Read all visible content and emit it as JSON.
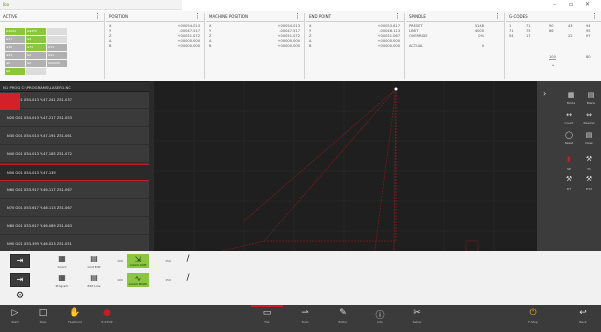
{
  "titlebar": {
    "app_label": "Ibo",
    "window_controls": [
      "–",
      "▫",
      "✕"
    ]
  },
  "infopanel": {
    "active": {
      "header": "ACTIVE",
      "cells": [
        [
          "G40X0",
          "G94T0",
          ""
        ],
        [
          "G17",
          "G4",
          "",
          ""
        ],
        [
          "G40",
          "G72",
          "G71",
          "G72"
        ],
        [
          "G21",
          "G0",
          "G91",
          "G90"
        ],
        [
          "G0",
          "G0",
          "",
          "G00000"
        ],
        [
          "G0",
          "G0.24L",
          "",
          ""
        ]
      ]
    },
    "position": {
      "header": "POSITION",
      "rows": [
        [
          "X",
          "+00054.013"
        ],
        [
          "Y",
          "-00047.517"
        ],
        [
          "Z",
          "+00051.072"
        ],
        [
          "A",
          "+00000.000"
        ],
        [
          "B",
          "+00000.000"
        ]
      ]
    },
    "machine_position": {
      "header": "MACHINE POSITION",
      "rows": [
        [
          "X",
          "+00054.013"
        ],
        [
          "Y",
          "-00047.517"
        ],
        [
          "Z",
          "+00051.072"
        ],
        [
          "A",
          "+00000.000"
        ],
        [
          "B",
          "+00000.000"
        ]
      ]
    },
    "end_point": {
      "header": "END POINT",
      "rows": [
        [
          "X",
          "+00053.617"
        ],
        [
          "Y",
          "-00046.113"
        ],
        [
          "Z",
          "+00051.067"
        ],
        [
          "A",
          "+00000.000"
        ],
        [
          "B",
          "+00000.000"
        ]
      ]
    },
    "spindle": {
      "header": "SPINDLE",
      "rows": [
        [
          "PRESET",
          "5148"
        ],
        [
          "LIMIT",
          "4000"
        ],
        [
          "OVERRIDE",
          "0%"
        ],
        [
          "",
          ""
        ],
        [
          "ACTUAL",
          "0"
        ]
      ]
    },
    "gcodes": {
      "header": "G-CODES",
      "grid": [
        [
          "1",
          "71",
          "90",
          "43",
          "94"
        ],
        [
          "71",
          "75",
          "66",
          "",
          "95"
        ],
        [
          "54",
          "17",
          "",
          "22",
          "97"
        ]
      ],
      "footer": [
        "100",
        "80"
      ]
    }
  },
  "program": {
    "header": "N1 PROG C:\\PROGRAMS\\LASER1.NC",
    "lines": [
      "N10 G01 X54.013 Y-47.241 Z51.037",
      "N20 G01 X54.013 Y-47.217 Z51.053",
      "N30 G01 X54.013 Y-47.191 Z51.061",
      "N40 G01 X54.013 Y-47.165 Z51.072",
      "N50 G01 X54.013 Y-47.139",
      "N60 G01 X53.917 Y-46.117 Z51.067",
      "N70 G01 X53.617 Y-46.113 Z51.067",
      "N80 G01 X53.617 Y-46.089 Z51.063",
      "N90 G01 X53.395 Y-46.023 Z51.051"
    ],
    "selected_index": 4
  },
  "graph": {
    "accent": "#c41e25",
    "trace_color": "#7d1d22",
    "grid_color": "#333333"
  },
  "sidepanel": {
    "items": [
      {
        "icon": "▦",
        "label": "Mode"
      },
      {
        "icon": "▤",
        "label": "Blank"
      },
      {
        "icon": "↔",
        "label": "Count"
      },
      {
        "icon": "⇔",
        "label": "Rewind"
      },
      {
        "icon": "◯",
        "label": "Reset"
      },
      {
        "icon": "▤",
        "label": "Clear"
      },
      {
        "icon": "▮",
        "label": "SP"
      },
      {
        "icon": "⚒",
        "label": "T1"
      },
      {
        "icon": "⚒",
        "label": "DT"
      },
      {
        "icon": "⚒",
        "label": "DT2"
      }
    ]
  },
  "softkeys": {
    "row1": [
      {
        "icon": "⇥",
        "label": "Feed"
      },
      {
        "icon": "▦",
        "label": "Coord"
      },
      {
        "icon": "▤",
        "label": "Grid Edit"
      },
      {
        "icon": "100",
        "label": ""
      },
      {
        "icon": "⇲",
        "label": "ALIGN LINE"
      },
      {
        "icon": "150",
        "label": ""
      },
      {
        "icon": "/",
        "label": ""
      }
    ],
    "row2": [
      {
        "icon": "⇥",
        "label": "Setup"
      },
      {
        "icon": "▦",
        "label": "Program"
      },
      {
        "icon": "▤",
        "label": "Edit Line"
      },
      {
        "icon": "100",
        "label": ""
      },
      {
        "icon": "∿",
        "label": "ALIGN MARK"
      },
      {
        "icon": "150",
        "label": ""
      },
      {
        "icon": "/",
        "label": ""
      }
    ],
    "row3": [
      {
        "icon": "⚙",
        "label": ""
      }
    ]
  },
  "bottombar": {
    "items": [
      {
        "icon": "▷",
        "label": "Start"
      },
      {
        "icon": "□",
        "label": "Stop"
      },
      {
        "icon": "✋",
        "label": "Feedhold"
      },
      {
        "icon": "●",
        "label": "E-STOP"
      },
      {
        "icon": "▭",
        "label": "File"
      },
      {
        "icon": "⇀",
        "label": "Tools"
      },
      {
        "icon": "✎",
        "label": "Editor"
      },
      {
        "icon": "ⓘ",
        "label": "Info"
      },
      {
        "icon": "✂",
        "label": "Setup"
      },
      {
        "icon": "⏻",
        "label": "F-Stop"
      },
      {
        "icon": "↩",
        "label": "Back"
      }
    ]
  }
}
